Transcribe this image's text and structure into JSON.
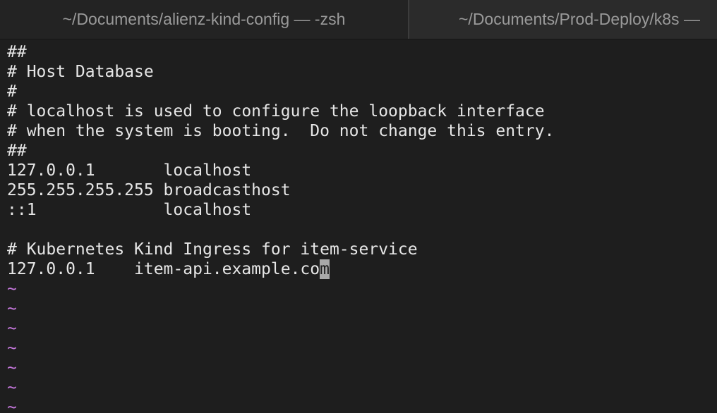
{
  "tabs": [
    {
      "label": "~/Documents/alienz-kind-config — -zsh"
    },
    {
      "label": "~/Documents/Prod-Deploy/k8s —"
    }
  ],
  "editor": {
    "lines": [
      "##",
      "# Host Database",
      "#",
      "# localhost is used to configure the loopback interface",
      "# when the system is booting.  Do not change this entry.",
      "##",
      "127.0.0.1       localhost",
      "255.255.255.255 broadcasthost",
      "::1             localhost",
      "",
      "# Kubernetes Kind Ingress for item-service",
      "127.0.0.1    item-api.example.co"
    ],
    "cursor_char": "m",
    "empty_marker": "~"
  },
  "colors": {
    "background": "#1e1e1e",
    "text": "#e6e6e6",
    "tilde": "#c678dd",
    "cursor": "#a9a9a9"
  }
}
